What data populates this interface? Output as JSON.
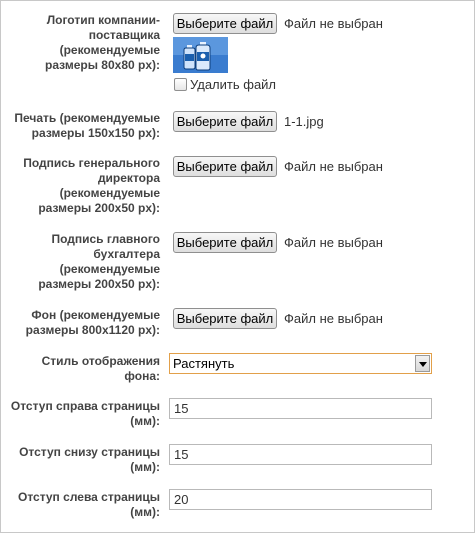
{
  "logo": {
    "label": "Логотип компании-поставщика (рекомендуемые размеры 80x80 px):",
    "button": "Выберите файл",
    "status": "Файл не выбран",
    "delete_label": "Удалить файл"
  },
  "stamp": {
    "label": "Печать (рекомендуемые размеры 150x150 px):",
    "button": "Выберите файл",
    "status": "1-1.jpg"
  },
  "director_signature": {
    "label": "Подпись генерального директора (рекомендуемые размеры 200x50 px):",
    "button": "Выберите файл",
    "status": "Файл не выбран"
  },
  "accountant_signature": {
    "label": "Подпись главного бухгалтера (рекомендуемые размеры 200x50 px):",
    "button": "Выберите файл",
    "status": "Файл не выбран"
  },
  "background": {
    "label": "Фон (рекомендуемые размеры 800x1120 px):",
    "button": "Выберите файл",
    "status": "Файл не выбран"
  },
  "display_style": {
    "label": "Стиль отображения фона:",
    "selected": "Растянуть"
  },
  "margin_right": {
    "label": "Отступ справа страницы (мм):",
    "value": "15"
  },
  "margin_bottom": {
    "label": "Отступ снизу страницы (мм):",
    "value": "15"
  },
  "margin_left": {
    "label": "Отступ слева страницы (мм):",
    "value": "20"
  },
  "icons": {
    "logo_thumbnail": "water-bottles-thumbnail",
    "select_arrow": "chevron-down-icon"
  },
  "colors": {
    "select_focus_border": "#e2a04a",
    "thumbnail_background": "#2f6fb8"
  }
}
